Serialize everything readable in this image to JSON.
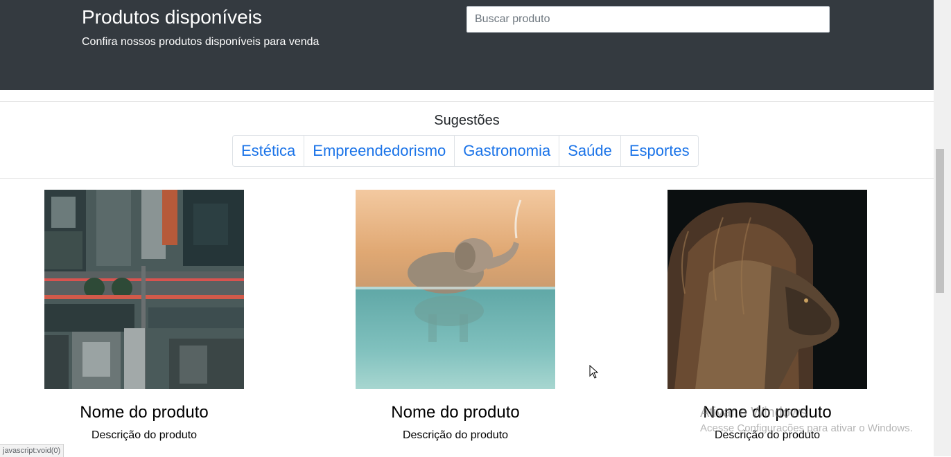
{
  "header": {
    "title": "Produtos disponíveis",
    "subtitle": "Confira nossos produtos disponíveis para venda",
    "search_placeholder": "Buscar produto"
  },
  "suggestions": {
    "title": "Sugestões",
    "categories": [
      "Estética",
      "Empreendedorismo",
      "Gastronomia",
      "Saúde",
      "Esportes"
    ]
  },
  "products": [
    {
      "name": "Nome do produto",
      "description": "Descrição do produto",
      "image": "city-aerial-photo"
    },
    {
      "name": "Nome do produto",
      "description": "Descrição do produto",
      "image": "elephant-in-water-photo"
    },
    {
      "name": "Nome do produto",
      "description": "Descrição do produto",
      "image": "lion-portrait-photo"
    }
  ],
  "status_bar": {
    "url": "javascript:void(0)"
  },
  "os_watermark": {
    "line1": "Ativar o Windows",
    "line2": "Acesse Configurações para ativar o Windows."
  },
  "colors": {
    "header_bg": "#343a40",
    "link": "#1a73e8"
  }
}
